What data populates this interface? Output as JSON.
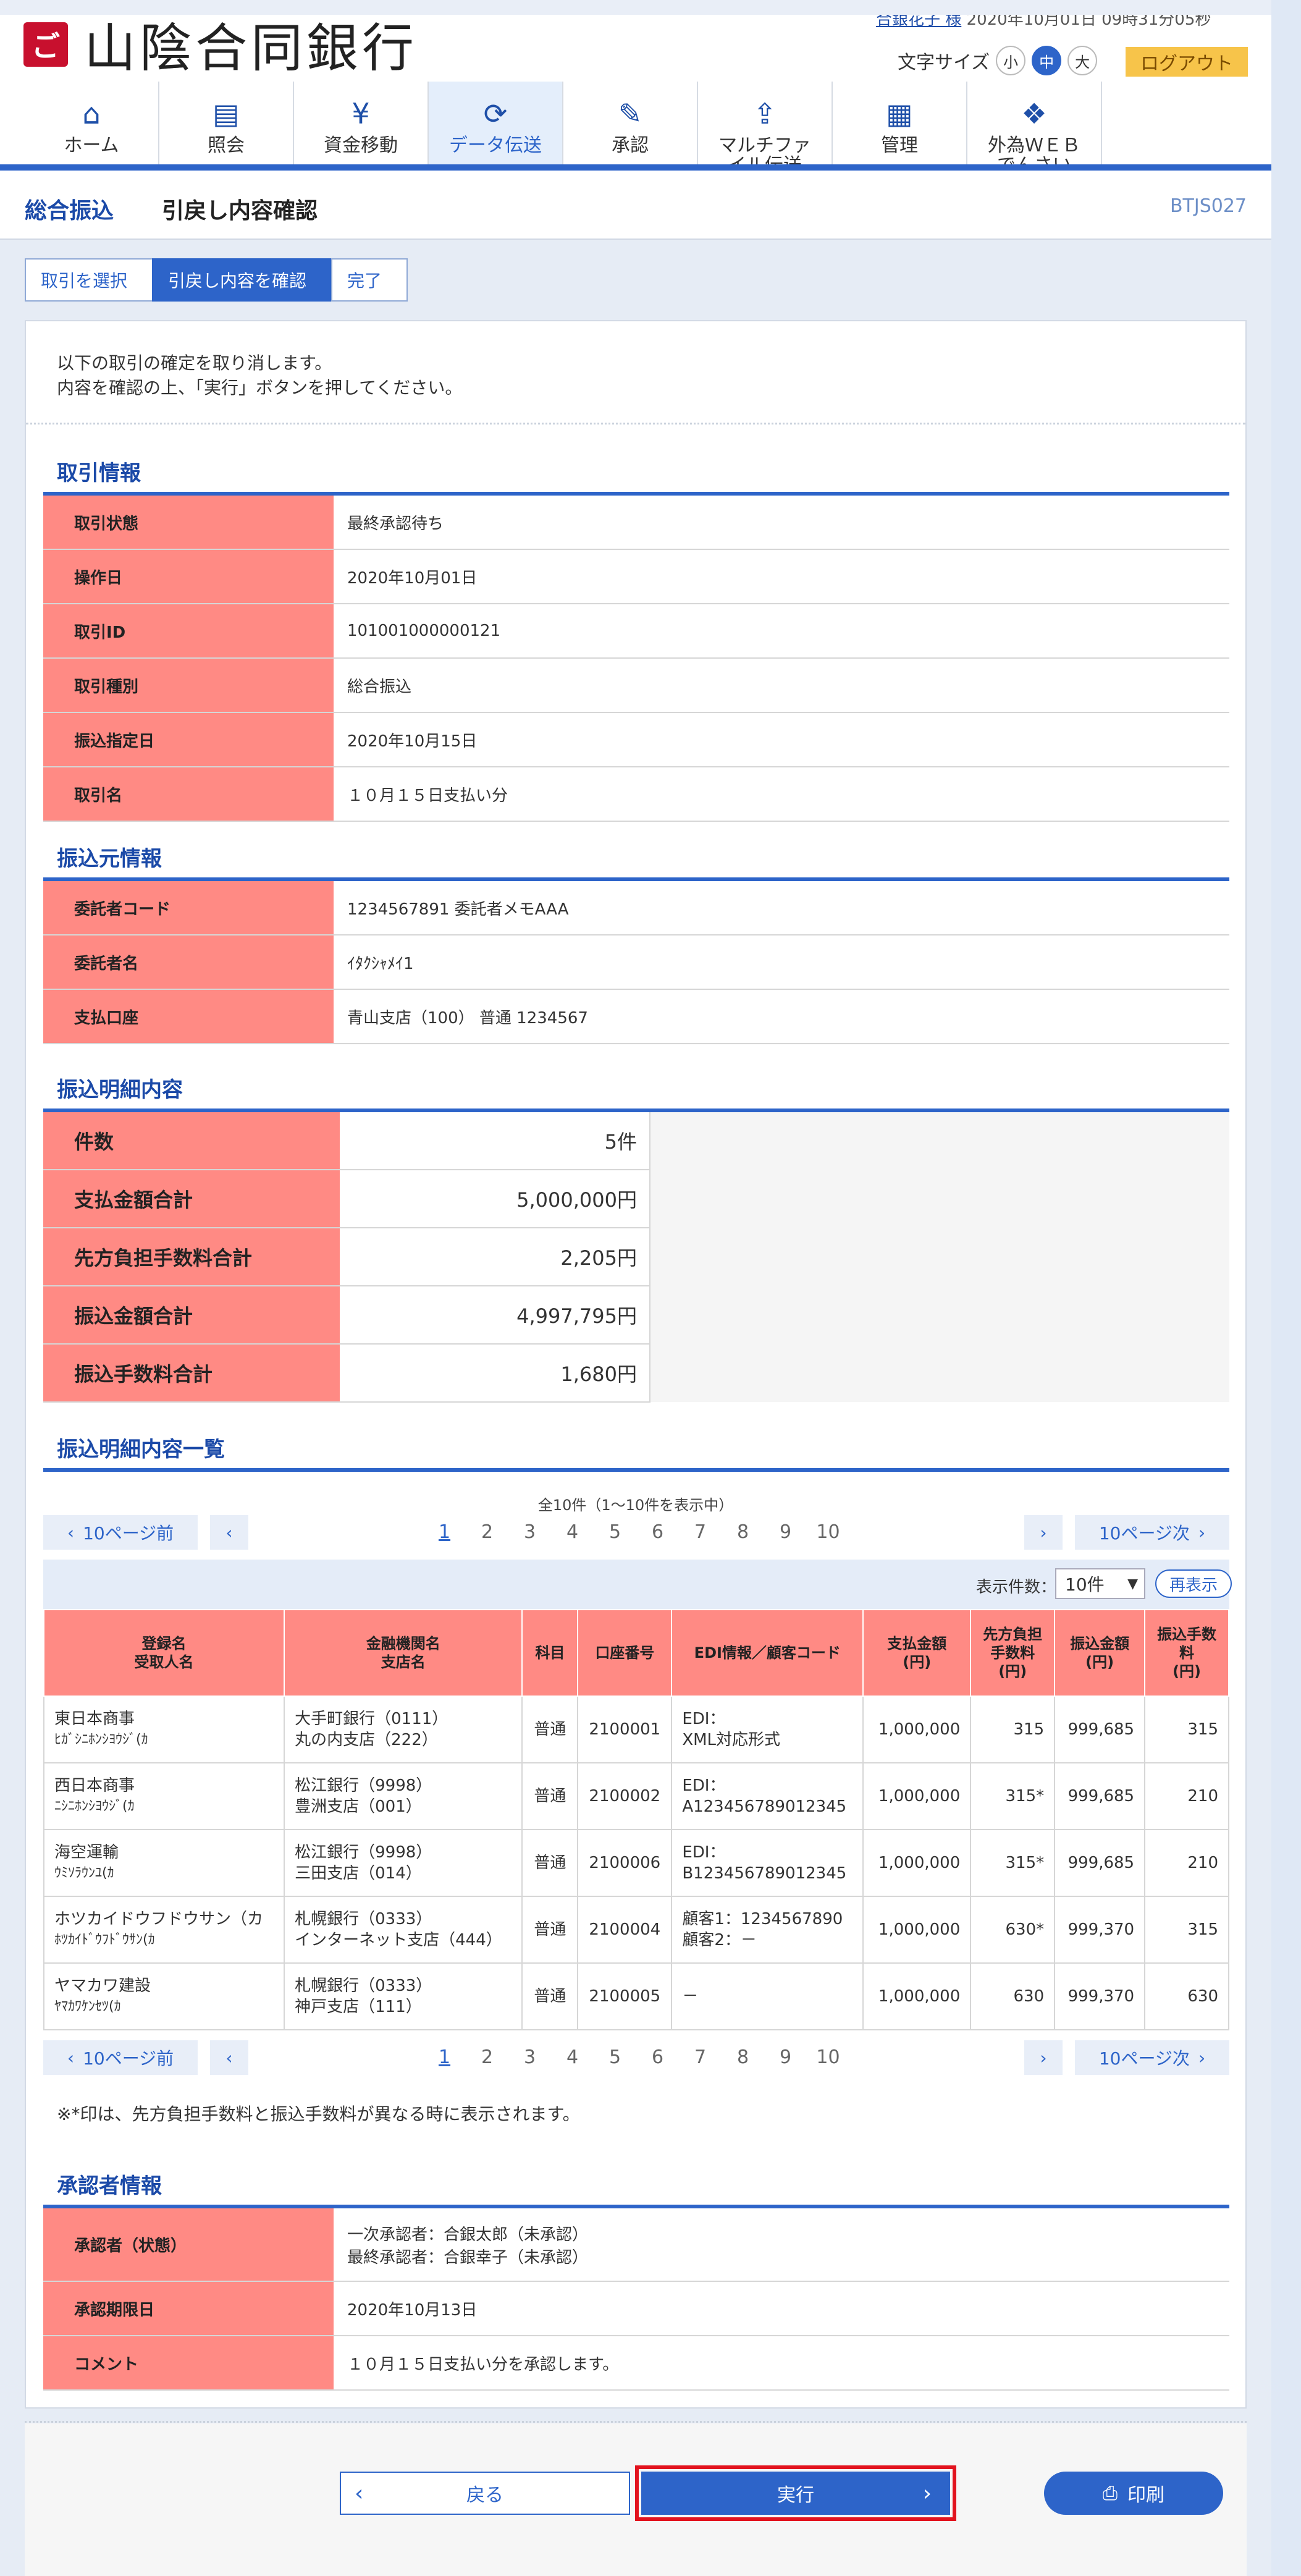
{
  "header": {
    "bank_name": "山陰合同銀行",
    "logo_mark": "ご",
    "user_line_name": "合銀花子 様",
    "user_line_rest": "2020年10月01日 09時31分05秒",
    "font_size_label": "文字サイズ",
    "font_sizes": [
      "小",
      "中",
      "大"
    ],
    "logout_label": "ログアウト"
  },
  "nav": [
    {
      "label": "ホーム",
      "icon": "home-icon",
      "glyph": "⌂"
    },
    {
      "label": "照会",
      "icon": "document-icon",
      "glyph": "▤"
    },
    {
      "label": "資金移動",
      "icon": "yen-transfer-icon",
      "glyph": "¥"
    },
    {
      "label": "データ伝送",
      "icon": "sync-icon",
      "glyph": "⟳"
    },
    {
      "label": "承認",
      "icon": "approve-document-icon",
      "glyph": "✎"
    },
    {
      "label": "マルチファイル伝送",
      "icon": "file-upload-icon",
      "glyph": "⇪"
    },
    {
      "label": "管理",
      "icon": "building-admin-icon",
      "glyph": "▦"
    },
    {
      "label": "外為ＷＥＢでんさい",
      "icon": "network-icon",
      "glyph": "❖"
    }
  ],
  "title": {
    "category": "総合振込",
    "main": "引戻し内容確認",
    "code": "BTJS027"
  },
  "steps": [
    "取引を選択",
    "引戻し内容を確認",
    "完了"
  ],
  "intro": {
    "line1": "以下の取引の確定を取り消します。",
    "line2": "内容を確認の上、「実行」ボタンを押してください。"
  },
  "torihiki": {
    "title": "取引情報",
    "rows": [
      {
        "k": "取引状態",
        "v": "最終承認待ち"
      },
      {
        "k": "操作日",
        "v": "2020年10月01日"
      },
      {
        "k": "取引ID",
        "v": "101001000000121"
      },
      {
        "k": "取引種別",
        "v": "総合振込"
      },
      {
        "k": "振込指定日",
        "v": "2020年10月15日"
      },
      {
        "k": "取引名",
        "v": "１０月１５日支払い分"
      }
    ]
  },
  "furikomimoto": {
    "title": "振込元情報",
    "rows": [
      {
        "k": "委託者コード",
        "v": "1234567891 委託者メモAAA"
      },
      {
        "k": "委託者名",
        "v": "ｲﾀｸｼｬﾒｲ1"
      },
      {
        "k": "支払口座",
        "v": "青山支店（100） 普通 1234567"
      }
    ]
  },
  "meisai": {
    "title": "振込明細内容",
    "rows": [
      {
        "k": "件数",
        "v": "5件"
      },
      {
        "k": "支払金額合計",
        "v": "5,000,000円"
      },
      {
        "k": "先方負担手数料合計",
        "v": "2,205円"
      },
      {
        "k": "振込金額合計",
        "v": "4,997,795円"
      },
      {
        "k": "振込手数料合計",
        "v": "1,680円"
      }
    ]
  },
  "ichiran": {
    "title": "振込明細内容一覧",
    "count_info": "全10件（1～10件を表示中）",
    "prev10": "10ページ前",
    "next10": "10ページ次",
    "pages": [
      "1",
      "2",
      "3",
      "4",
      "5",
      "6",
      "7",
      "8",
      "9",
      "10"
    ],
    "display_label": "表示件数：",
    "display_value": "10件",
    "redisplay": "再表示",
    "headers": {
      "name1": "登録名",
      "name2": "受取人名",
      "bank1": "金融機関名",
      "bank2": "支店名",
      "kamoku": "科目",
      "koza": "口座番号",
      "edi": "EDI情報／顧客コード",
      "shiharai1": "支払金額",
      "shiharai2": "(円)",
      "senpo1": "先方負担",
      "senpo2": "手数料",
      "senpo3": "(円)",
      "furikomi1": "振込金額",
      "furikomi2": "(円)",
      "tesuryo1": "振込手数",
      "tesuryo2": "料",
      "tesuryo3": "(円)"
    },
    "rows": [
      {
        "name1": "東日本商事",
        "name2": "ﾋｶﾞｼﾆﾎﾝｼﾖｳｼﾞ(ｶ",
        "bank1": "大手町銀行（0111）",
        "bank2": "丸の内支店（222）",
        "kamoku": "普通",
        "koza": "2100001",
        "edi1": "EDI：",
        "edi2": "XML対応形式",
        "shiharai": "1,000,000",
        "senpo": "315",
        "furikomi": "999,685",
        "tesuryo": "315"
      },
      {
        "name1": "西日本商事",
        "name2": "ﾆｼﾆﾎﾝｼﾖｳｼﾞ(ｶ",
        "bank1": "松江銀行（9998）",
        "bank2": "豊洲支店（001）",
        "kamoku": "普通",
        "koza": "2100002",
        "edi1": "EDI：",
        "edi2": "A123456789012345",
        "shiharai": "1,000,000",
        "senpo": "315*",
        "furikomi": "999,685",
        "tesuryo": "210"
      },
      {
        "name1": "海空運輸",
        "name2": "ｳﾐｿﾗｳﾝﾕ(ｶ",
        "bank1": "松江銀行（9998）",
        "bank2": "三田支店（014）",
        "kamoku": "普通",
        "koza": "2100006",
        "edi1": "EDI：",
        "edi2": "B123456789012345",
        "shiharai": "1,000,000",
        "senpo": "315*",
        "furikomi": "999,685",
        "tesuryo": "210"
      },
      {
        "name1": "ホツカイドウフドウサン（カ",
        "name2": "ﾎﾂｶｲﾄﾞｳﾌﾄﾞｳｻﾝ(ｶ",
        "bank1": "札幌銀行（0333）",
        "bank2": "インターネット支店（444）",
        "kamoku": "普通",
        "koza": "2100004",
        "edi1": "顧客1：1234567890",
        "edi2": "顧客2：－",
        "shiharai": "1,000,000",
        "senpo": "630*",
        "furikomi": "999,370",
        "tesuryo": "315"
      },
      {
        "name1": "ヤマカワ建設",
        "name2": "ﾔﾏｶﾜｹﾝｾﾂ(ｶ",
        "bank1": "札幌銀行（0333）",
        "bank2": "神戸支店（111）",
        "kamoku": "普通",
        "koza": "2100005",
        "edi1": "－",
        "edi2": "",
        "shiharai": "1,000,000",
        "senpo": "630",
        "furikomi": "999,370",
        "tesuryo": "630"
      }
    ],
    "note": "※*印は、先方負担手数料と振込手数料が異なる時に表示されます。"
  },
  "shoninsha": {
    "title": "承認者情報",
    "status_label": "承認者（状態）",
    "status_line1": "一次承認者：合銀太郎（未承認）",
    "status_line2": "最終承認者：合銀幸子（未承認）",
    "rows": [
      {
        "k": "承認期限日",
        "v": "2020年10月13日"
      },
      {
        "k": "コメント",
        "v": "１０月１５日支払い分を承認します。"
      }
    ]
  },
  "buttons": {
    "back": "戻る",
    "exec": "実行",
    "print": "印刷"
  },
  "colors": {
    "accent": "#2d64c9",
    "label_bg": "#ff8a84",
    "highlight": "#e2131e",
    "logout_bg": "#f7c44a"
  }
}
